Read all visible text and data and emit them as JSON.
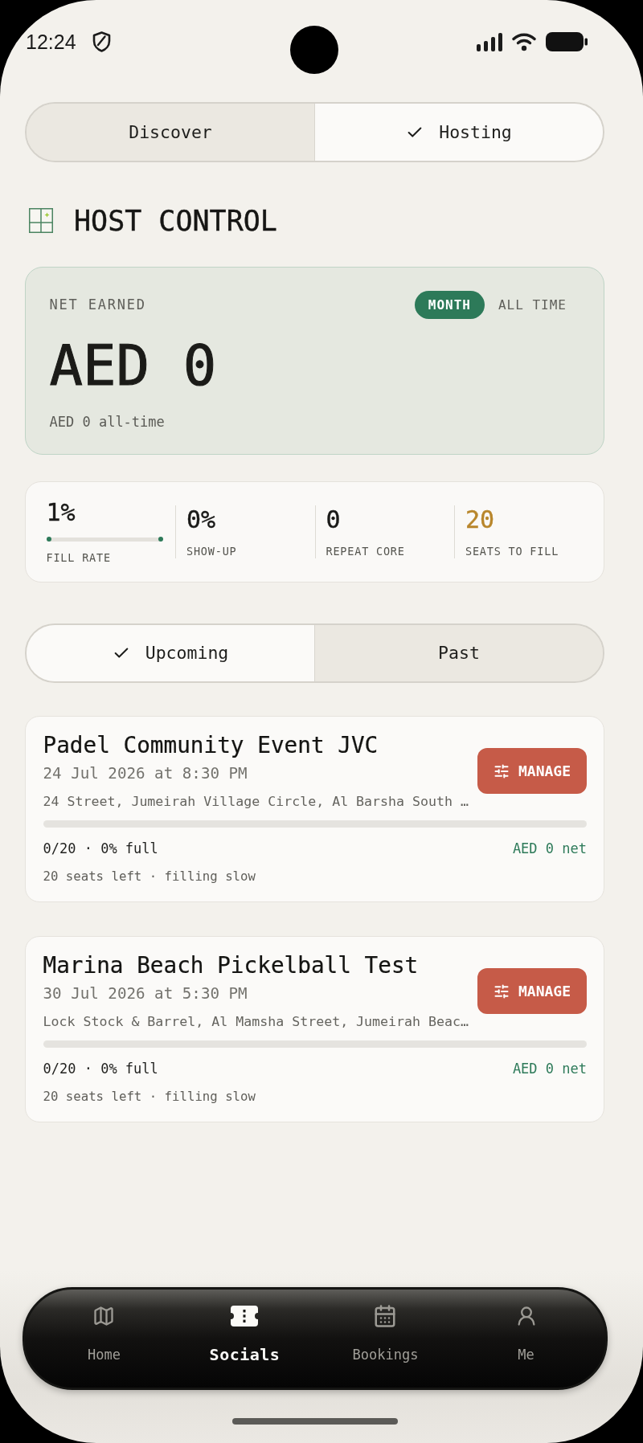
{
  "status_bar": {
    "time": "12:24"
  },
  "mode_tabs": [
    {
      "label": "Discover",
      "selected": false
    },
    {
      "label": "Hosting",
      "selected": true
    }
  ],
  "section": {
    "title": "HOST CONTROL"
  },
  "earnings": {
    "label": "NET EARNED",
    "periods": [
      {
        "label": "MONTH",
        "selected": true
      },
      {
        "label": "ALL TIME",
        "selected": false
      }
    ],
    "amount": "AED 0",
    "subtitle": "AED 0 all-time"
  },
  "stats": [
    {
      "kind": "progress",
      "value": "1%",
      "label": "FILL RATE",
      "level": 0.01,
      "color": "#1a1a18"
    },
    {
      "kind": "plain",
      "value": "0%",
      "label": "SHOW-UP",
      "color": "#1a1a18"
    },
    {
      "kind": "plain",
      "value": "0",
      "label": "REPEAT CORE",
      "color": "#1a1a18"
    },
    {
      "kind": "plain",
      "value": "20",
      "label": "SEATS TO FILL",
      "color": "#b8862b"
    }
  ],
  "list_tabs": [
    {
      "label": "Upcoming",
      "selected": true
    },
    {
      "label": "Past",
      "selected": false
    }
  ],
  "events": [
    {
      "title": "Padel Community Event JVC",
      "datetime": "24 Jul 2026 at 8:30 PM",
      "address": "24 Street, Jumeirah Village Circle, Al Barsha South …",
      "action": "MANAGE",
      "occupancy": "0/20 · 0% full",
      "net": "AED 0 net",
      "note": "20 seats left · filling slow"
    },
    {
      "title": "Marina Beach Pickelball Test",
      "datetime": "30 Jul 2026 at 5:30 PM",
      "address": "Lock Stock & Barrel, Al Mamsha Street, Jumeirah Beac…",
      "action": "MANAGE",
      "occupancy": "0/20 · 0% full",
      "net": "AED 0 net",
      "note": "20 seats left · filling slow"
    }
  ],
  "bottom_nav": [
    {
      "label": "Home",
      "selected": false
    },
    {
      "label": "Socials",
      "selected": true
    },
    {
      "label": "Bookings",
      "selected": false
    },
    {
      "label": "Me",
      "selected": false
    }
  ]
}
